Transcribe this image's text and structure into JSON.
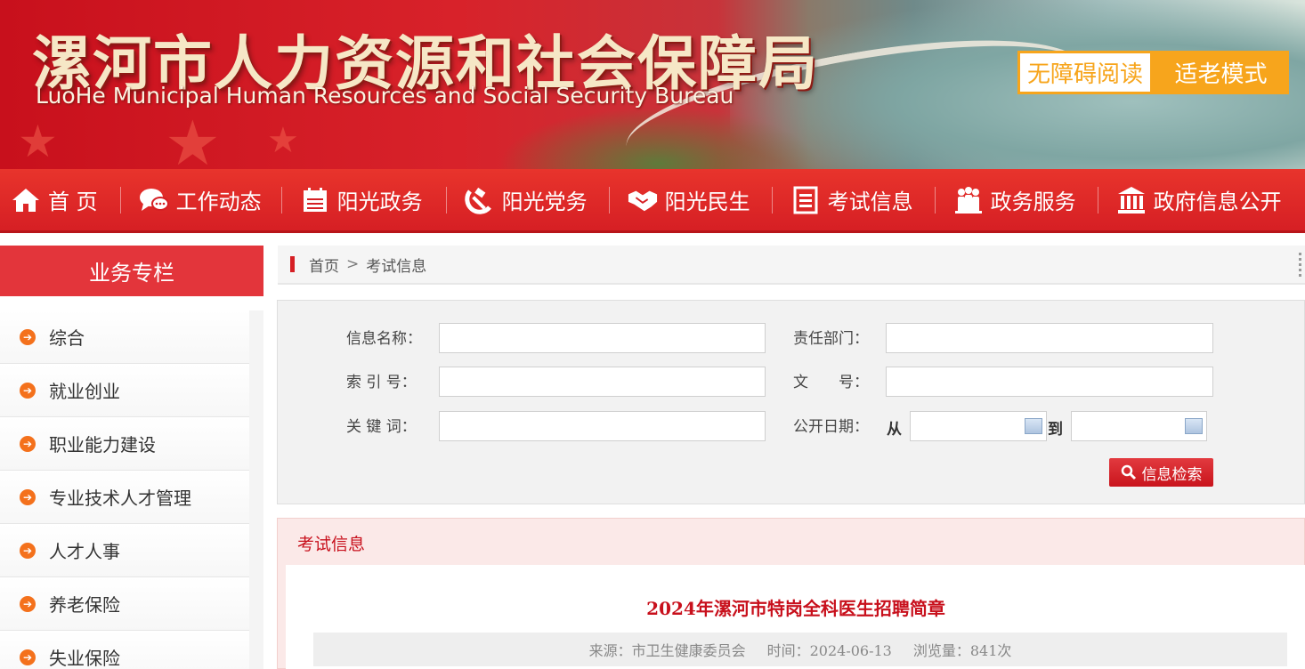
{
  "header": {
    "title_cn": "漯河市人力资源和社会保障局",
    "title_en": "LuoHe Municipal Human Resources and Social Security Bureau",
    "accessibility_label": "无障碍阅读",
    "elder_mode_label": "适老模式",
    "colors": {
      "accent": "#f7a51c",
      "brand_red": "#d61f24"
    }
  },
  "nav": {
    "items": [
      {
        "label": "首 页",
        "icon": "home-icon"
      },
      {
        "label": "工作动态",
        "icon": "chat-bubbles-icon"
      },
      {
        "label": "阳光政务",
        "icon": "calendar-icon"
      },
      {
        "label": "阳光党务",
        "icon": "hammer-sickle-icon"
      },
      {
        "label": "阳光民生",
        "icon": "handshake-icon"
      },
      {
        "label": "考试信息",
        "icon": "document-icon"
      },
      {
        "label": "政务服务",
        "icon": "people-icon"
      },
      {
        "label": "政府信息公开",
        "icon": "government-building-icon"
      }
    ]
  },
  "sidebar": {
    "title": "业务专栏",
    "items": [
      {
        "label": "综合"
      },
      {
        "label": "就业创业"
      },
      {
        "label": "职业能力建设"
      },
      {
        "label": "专业技术人才管理"
      },
      {
        "label": "人才人事"
      },
      {
        "label": "养老保险"
      },
      {
        "label": "失业保险"
      }
    ]
  },
  "breadcrumb": {
    "home": "首页",
    "separator": ">",
    "current": "考试信息"
  },
  "search": {
    "info_name_label": "信息名称：",
    "dept_label": "责任部门：",
    "index_label": "索 引 号：",
    "doc_no_label": "文　　号：",
    "keyword_label": "关 键 词：",
    "date_label": "公开日期：",
    "from_label": "从",
    "to_label": "到",
    "submit_label": "信息检索"
  },
  "panel": {
    "title": "考试信息",
    "article": {
      "title": "2024年漯河市特岗全科医生招聘简章",
      "source": "来源：市卫生健康委员会",
      "time": "时间：2024-06-13",
      "views": "浏览量：841次"
    }
  }
}
